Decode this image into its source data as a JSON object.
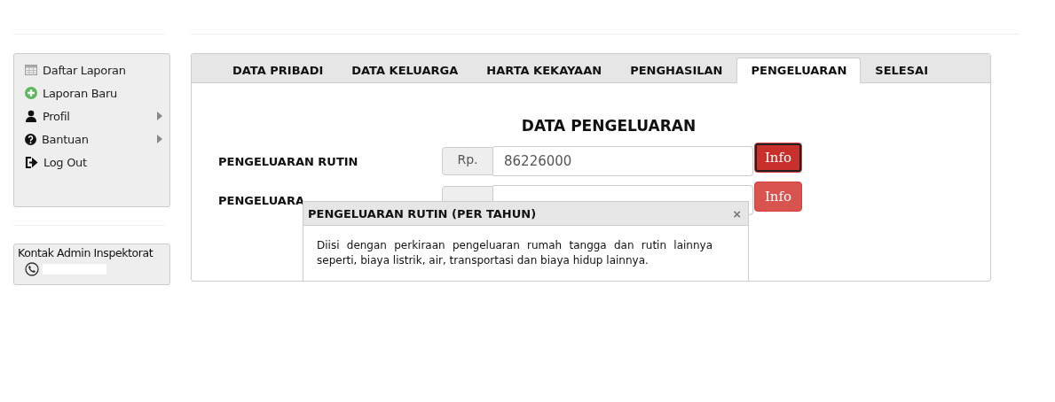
{
  "sidebar": {
    "menu": [
      {
        "label": "Daftar Laporan",
        "submenu": false
      },
      {
        "label": "Laporan Baru",
        "submenu": false
      },
      {
        "label": "Profil",
        "submenu": true
      },
      {
        "label": "Bantuan",
        "submenu": true
      },
      {
        "label": "Log Out",
        "submenu": false
      }
    ],
    "contact": {
      "title": "Kontak Admin Inspektorat"
    }
  },
  "tabs": [
    {
      "label": "DATA PRIBADI",
      "selected": false
    },
    {
      "label": "DATA KELUARGA",
      "selected": false
    },
    {
      "label": "HARTA KEKAYAAN",
      "selected": false
    },
    {
      "label": "PENGHASILAN",
      "selected": false
    },
    {
      "label": "PENGELUARAN",
      "selected": true
    },
    {
      "label": "SELESAI",
      "selected": false
    }
  ],
  "form": {
    "title": "DATA PENGELUARAN",
    "rows": [
      {
        "label": "PENGELUARAN RUTIN",
        "prefix": "Rp.",
        "value": "86226000",
        "button": "Info",
        "focused": true
      },
      {
        "label": "PENGELUARA",
        "button": "Info",
        "focused": false
      }
    ]
  },
  "popover": {
    "title": "PENGELUARAN RUTIN (PER TAHUN)",
    "close": "×",
    "body": "Diisi dengan perkiraan pengeluaran rumah tangga dan rutin lainnya seperti, biaya listrik, air, transportasi dan biaya hidup lainnya."
  }
}
